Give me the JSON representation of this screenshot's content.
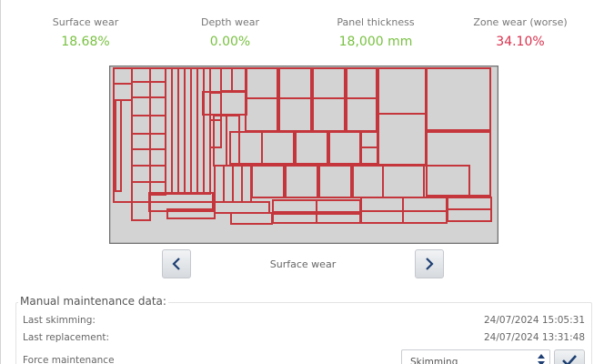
{
  "stats": [
    {
      "label": "Surface wear",
      "value": "18.68%",
      "status": "ok"
    },
    {
      "label": "Depth wear",
      "value": "0.00%",
      "status": "ok"
    },
    {
      "label": "Panel thickness",
      "value": "18,000 mm",
      "status": "ok"
    },
    {
      "label": "Zone wear (worse)",
      "value": "34.10%",
      "status": "bad"
    }
  ],
  "colors": {
    "ok": "#79c142",
    "bad": "#d9324e",
    "panel_fill": "#d3d3d3",
    "cut_line": "#c4363c",
    "nav_arrow": "#1d3f73"
  },
  "map": {
    "caption": "Surface wear",
    "prev_icon": "chevron-left-icon",
    "next_icon": "chevron-right-icon"
  },
  "maintenance": {
    "title": "Manual maintenance data:",
    "last_skimming_label": "Last skimming:",
    "last_skimming_value": "24/07/2024 15:05:31",
    "last_replacement_label": "Last replacement:",
    "last_replacement_value": "24/07/2024 13:31:48",
    "force_label": "Force maintenance",
    "force_select_value": "Skimming",
    "confirm_icon": "checkmark-icon"
  }
}
